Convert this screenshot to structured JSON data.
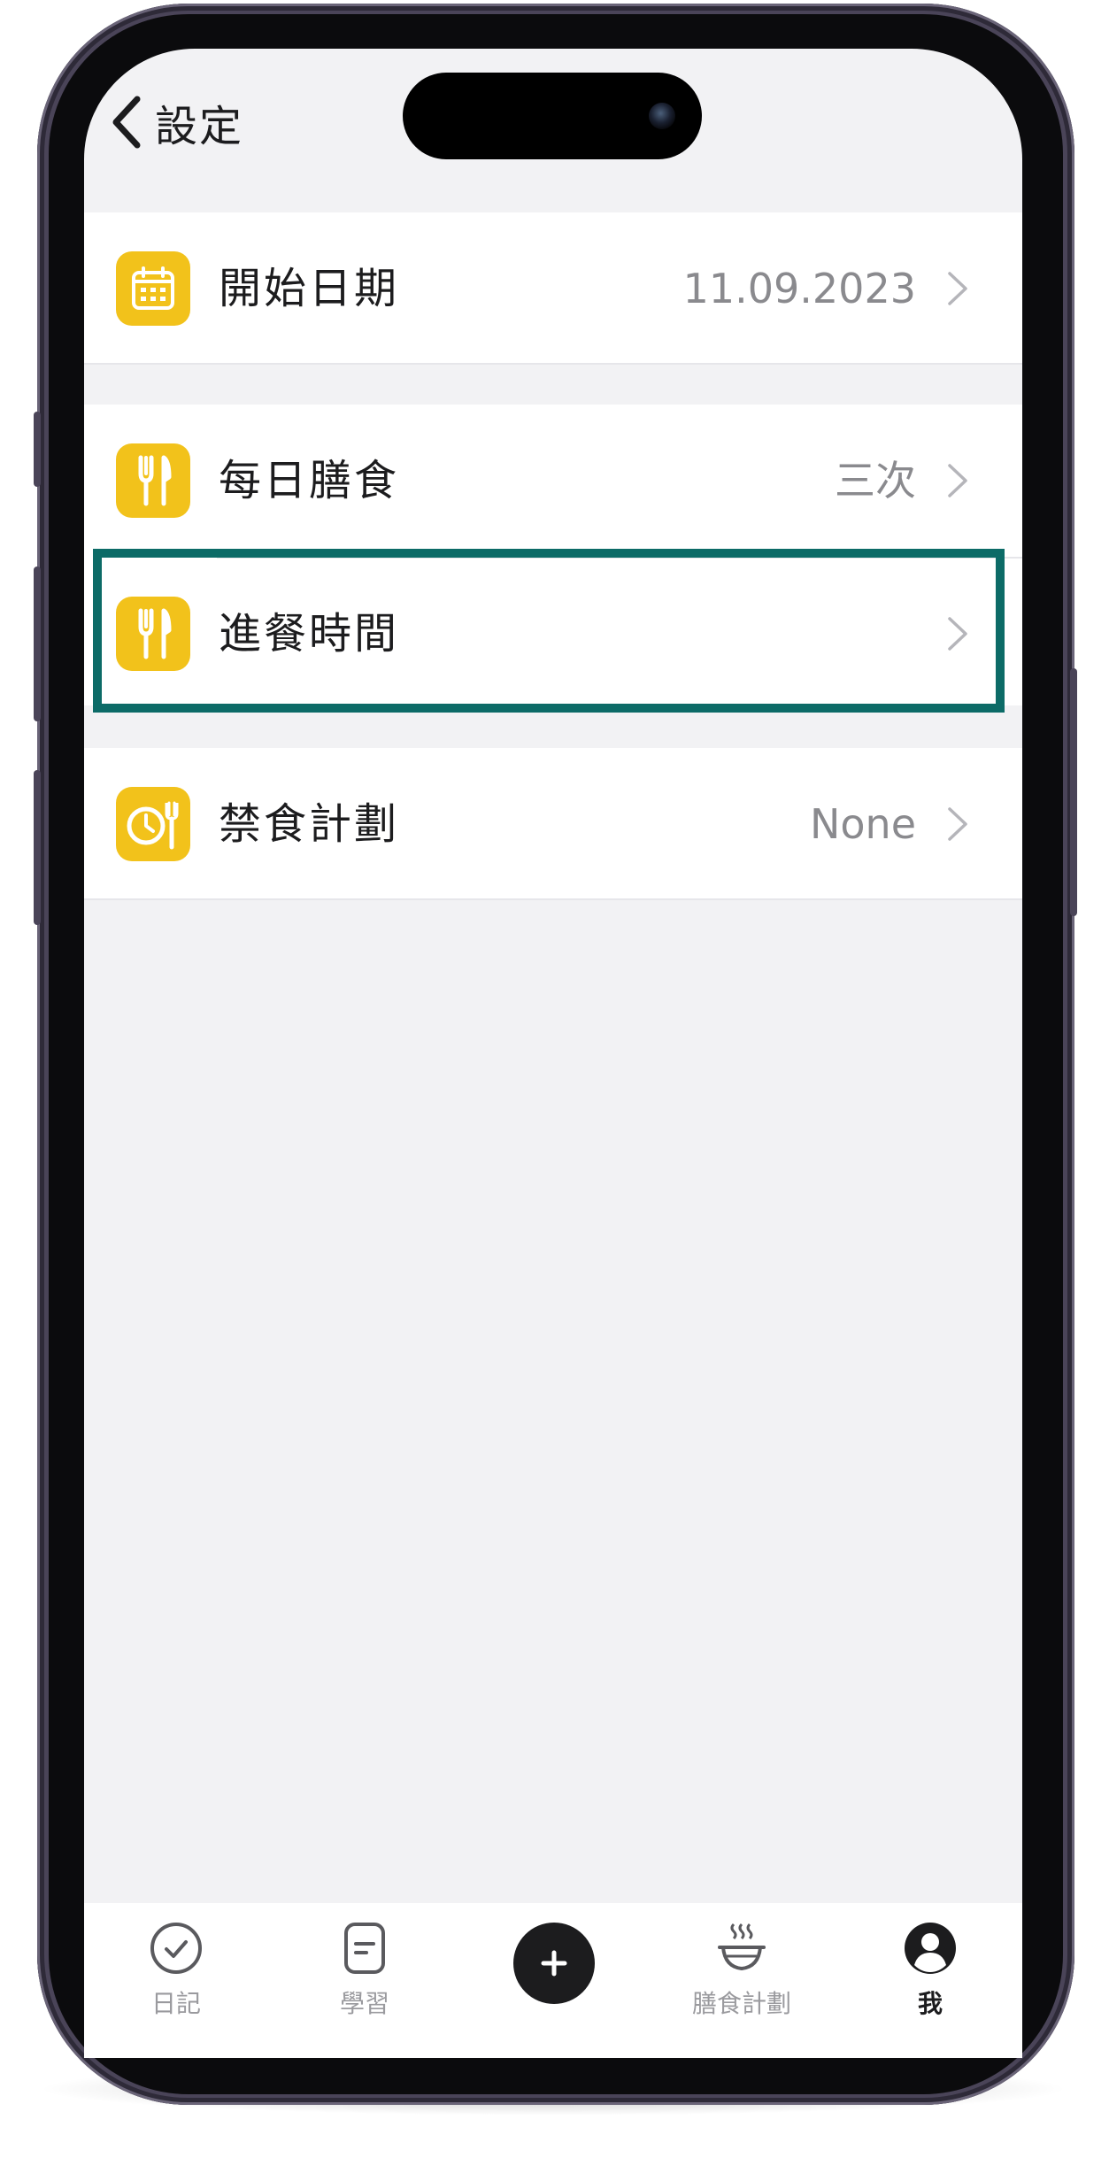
{
  "header": {
    "back_icon": "chevron-left-icon",
    "title": "設定"
  },
  "settings": {
    "start_date": {
      "icon": "calendar-icon",
      "label": "開始日期",
      "value": "11.09.2023"
    },
    "daily_meals": {
      "icon": "fork-knife-icon",
      "label": "每日膳食",
      "value": "三次"
    },
    "meal_times": {
      "icon": "fork-knife-icon",
      "label": "進餐時間",
      "value": ""
    },
    "fasting_plan": {
      "icon": "clock-fork-icon",
      "label": "禁食計劃",
      "value": "None"
    }
  },
  "tabbar": {
    "diary": {
      "icon": "check-circle-icon",
      "label": "日記"
    },
    "learn": {
      "icon": "document-icon",
      "label": "學習"
    },
    "add": {
      "icon": "plus-icon"
    },
    "meal_plan": {
      "icon": "steaming-bowl-icon",
      "label": "膳食計劃"
    },
    "me": {
      "icon": "profile-icon",
      "label": "我",
      "active": true
    }
  },
  "colors": {
    "accent_icon": "#f2c21b",
    "highlight_box": "#0c6b67",
    "background": "#f2f2f4"
  }
}
